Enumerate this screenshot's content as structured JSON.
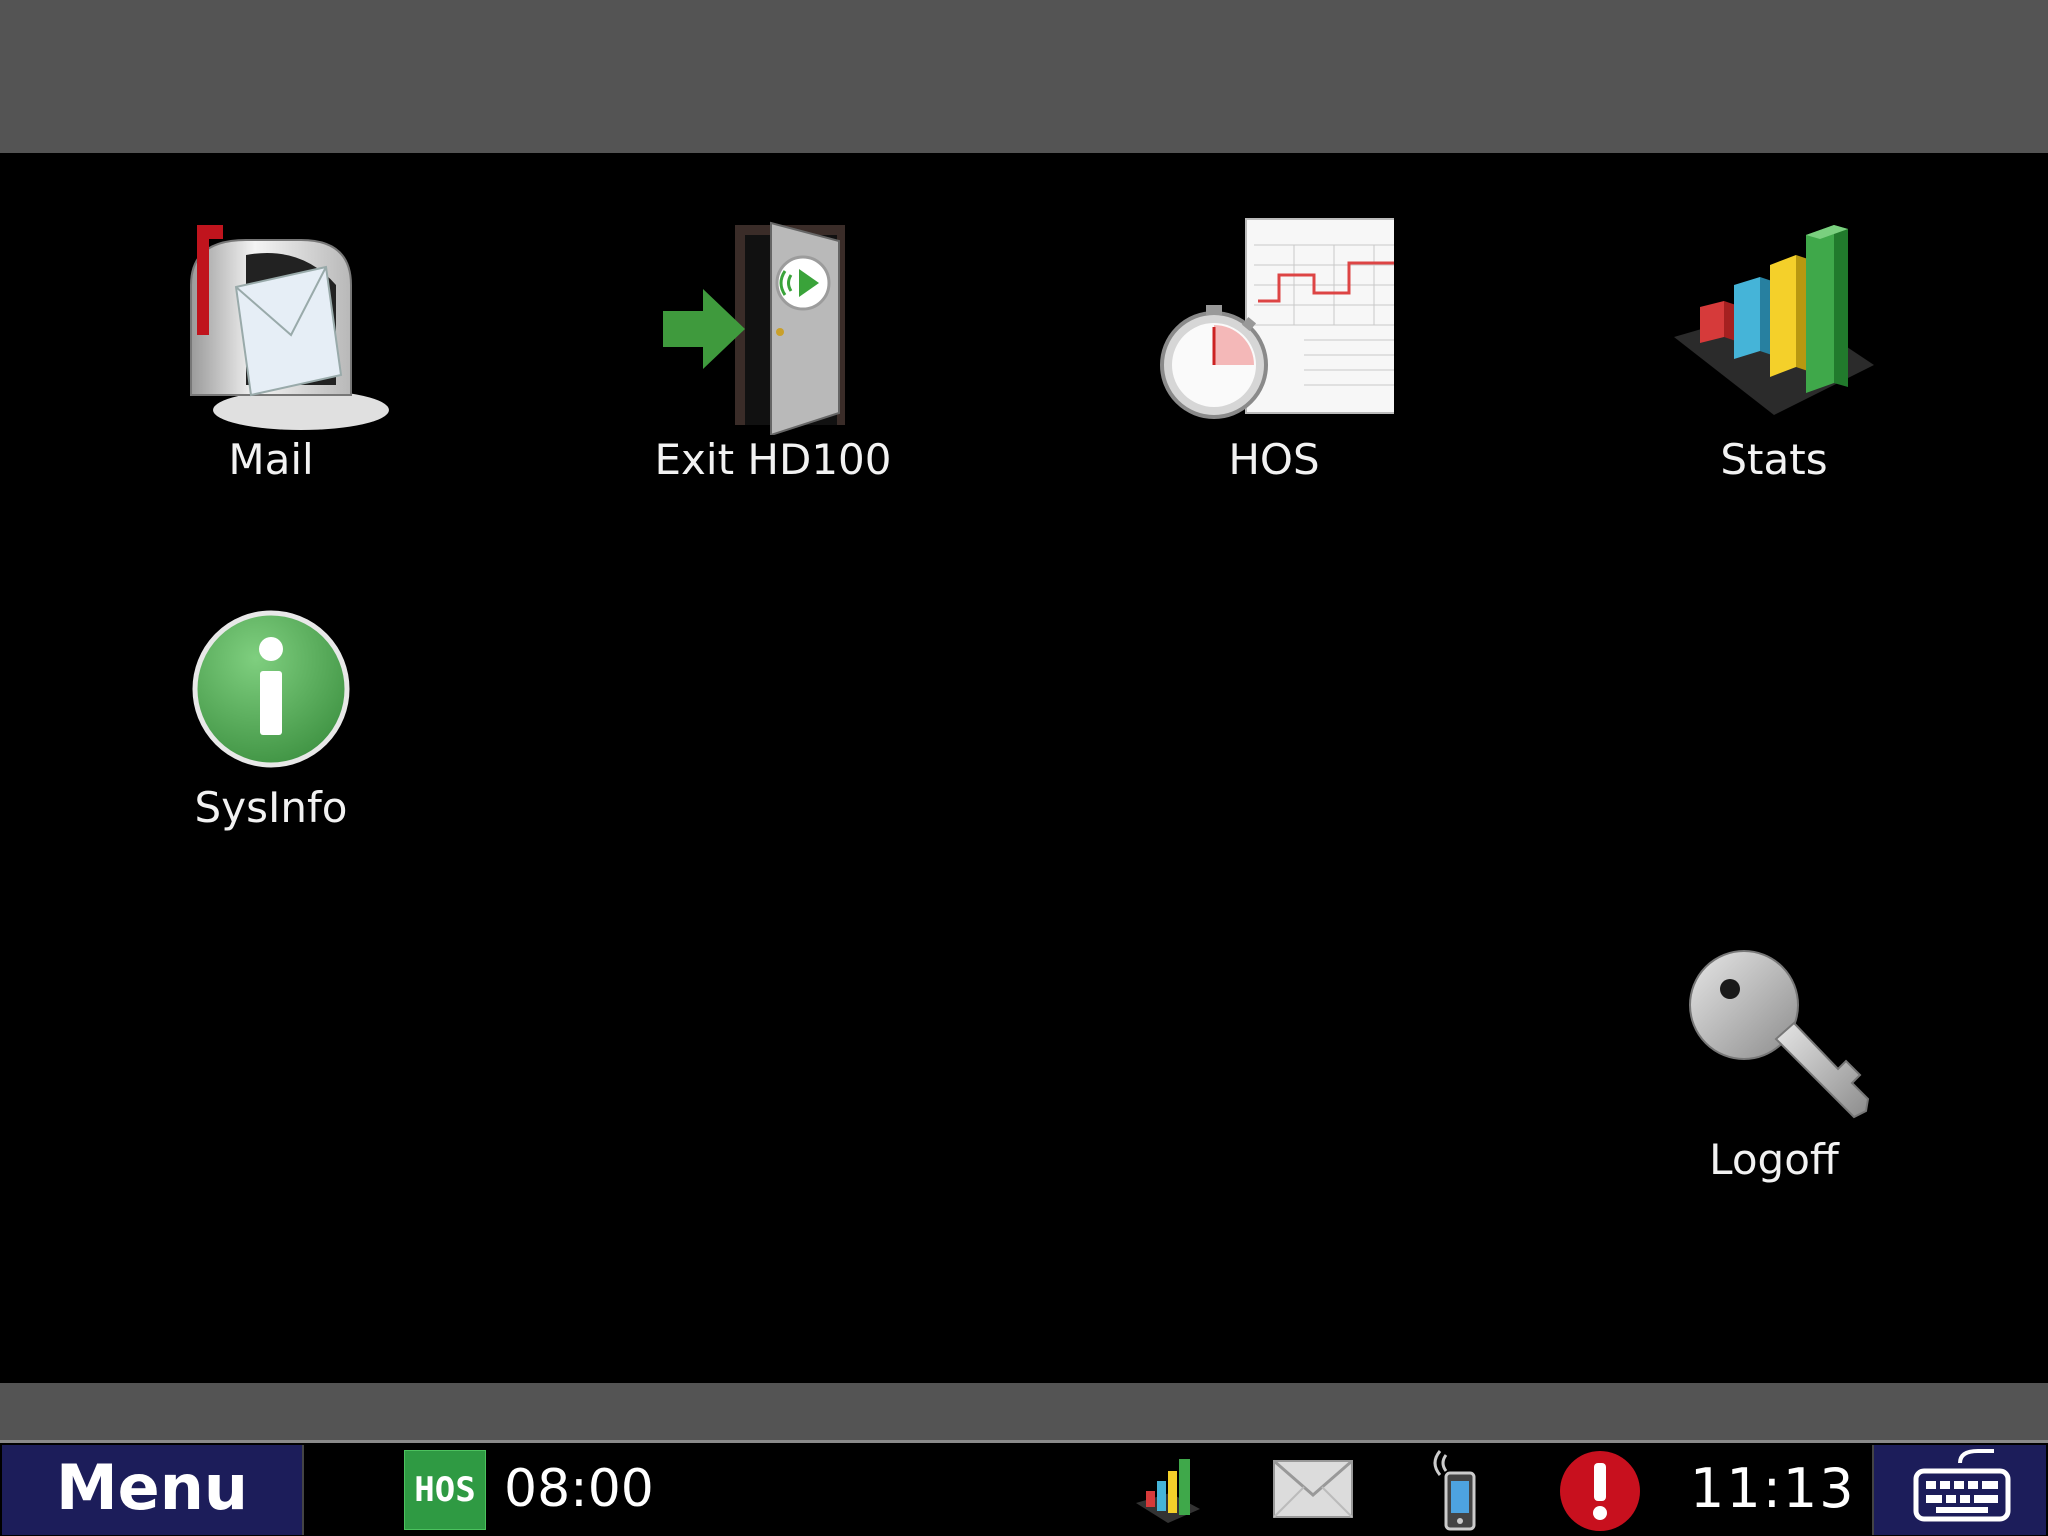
{
  "apps": [
    {
      "label": "Mail",
      "icon": "mailbox-icon"
    },
    {
      "label": "Exit HD100",
      "icon": "exit-door-icon"
    },
    {
      "label": "HOS",
      "icon": "hos-logbook-stopwatch-icon"
    },
    {
      "label": "Stats",
      "icon": "bar-chart-icon"
    },
    {
      "label": "SysInfo",
      "icon": "info-icon"
    },
    {
      "label": "Logoff",
      "icon": "key-icon"
    }
  ],
  "taskbar": {
    "menu_label": "Menu",
    "hos_badge": "HOS",
    "hos_time": "08:00",
    "status_icons": [
      "stats-mini-icon",
      "mail-envelope-icon",
      "mobile-signal-icon",
      "alert-icon"
    ],
    "clock": "11:13",
    "keyboard_icon": "keyboard-icon"
  },
  "colors": {
    "background": "#000000",
    "frame": "#545454",
    "menu_button": "#1c1d5a",
    "hos_badge": "#2f9a43",
    "alert": "#c8101e"
  }
}
